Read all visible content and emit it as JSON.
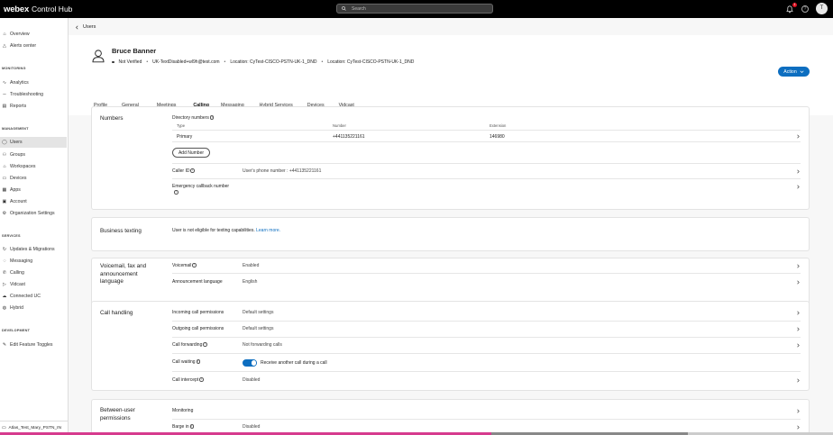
{
  "topbar": {
    "brand": "webex",
    "product": "Control Hub",
    "search_placeholder": "Search",
    "notification_count": "1",
    "avatar_initial": "T"
  },
  "sidebar": {
    "items": [
      {
        "label": "Overview",
        "icon": "home-icon"
      },
      {
        "label": "Alerts center",
        "icon": "bell-icon"
      },
      {
        "section": "MONITORING"
      },
      {
        "label": "Analytics",
        "icon": "analytics-icon"
      },
      {
        "label": "Troubleshooting",
        "icon": "pulse-icon"
      },
      {
        "label": "Reports",
        "icon": "report-icon"
      },
      {
        "section": "MANAGEMENT"
      },
      {
        "label": "Users",
        "icon": "user-icon",
        "active": true
      },
      {
        "label": "Groups",
        "icon": "group-icon"
      },
      {
        "label": "Workspaces",
        "icon": "workspace-icon"
      },
      {
        "label": "Devices",
        "icon": "device-icon"
      },
      {
        "label": "Apps",
        "icon": "apps-icon"
      },
      {
        "label": "Account",
        "icon": "account-icon"
      },
      {
        "label": "Organization Settings",
        "icon": "settings-icon"
      },
      {
        "section": "SERVICES"
      },
      {
        "label": "Updates & Migrations",
        "icon": "refresh-icon"
      },
      {
        "label": "Messaging",
        "icon": "chat-icon"
      },
      {
        "label": "Calling",
        "icon": "phone-icon"
      },
      {
        "label": "Vidcast",
        "icon": "play-icon"
      },
      {
        "label": "Connected UC",
        "icon": "cloud-icon"
      },
      {
        "label": "Hybrid",
        "icon": "hybrid-icon"
      },
      {
        "section": "DEVELOPMENT"
      },
      {
        "label": "Edit Feature Toggles",
        "icon": "edit-icon"
      }
    ],
    "footer": "Atlas_Test_Mary_PSTN_IN"
  },
  "back_label": "Users",
  "user": {
    "name": "Bruce Banner",
    "status": "Not Verified",
    "email": "UK-TextDisabled+wl9h@test.com",
    "location1": "Location: CyTest-CISCO-PSTN-UK-1_DND",
    "location2": "Location: CyTest-CISCO-PSTN-UK-1_DND"
  },
  "action_label": "Action",
  "tabs": [
    "Profile",
    "General",
    "Meetings",
    "Calling",
    "Messaging",
    "Hybrid Services",
    "Devices",
    "Vidcast"
  ],
  "active_tab": "Calling",
  "numbers": {
    "title": "Numbers",
    "directory_label": "Directory numbers",
    "col_type": "Type",
    "col_number": "Number",
    "col_extension": "Extension",
    "row_type": "Primary",
    "row_number": "+441135221161",
    "row_extension": "146980",
    "add_number": "Add Number",
    "caller_id_label": "Caller ID",
    "caller_id_value": "User's phone number : +441135221161",
    "emergency_label": "Emergency callback number"
  },
  "business_texting": {
    "title": "Business texting",
    "text": "User is not eligible for texting capabilities.",
    "link": "Learn more."
  },
  "voicemail": {
    "title": "Voicemail, fax and announcement language",
    "voicemail_label": "Voicemail",
    "voicemail_value": "Enabled",
    "announcement_label": "Announcement language",
    "announcement_value": "English"
  },
  "call_handling": {
    "title": "Call handling",
    "incoming_label": "Incoming call permissions",
    "incoming_value": "Default settings",
    "outgoing_label": "Outgoing call permissions",
    "outgoing_value": "Default settings",
    "forwarding_label": "Call forwarding",
    "forwarding_value": "Not forwarding calls",
    "waiting_label": "Call waiting",
    "waiting_value": "Receive another call during a call",
    "intercept_label": "Call intercept",
    "intercept_value": "Disabled"
  },
  "between_user": {
    "title": "Between-user permissions",
    "monitoring_label": "Monitoring",
    "barge_label": "Barge in",
    "barge_value": "Disabled"
  },
  "colors": {
    "accent": "#0d6ec0",
    "progress": "#d63b8e"
  }
}
